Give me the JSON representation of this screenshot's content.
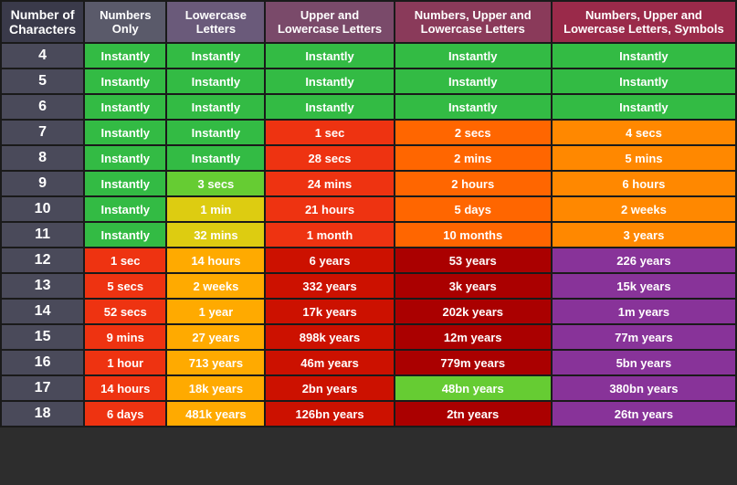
{
  "headers": {
    "col0": "Number of Characters",
    "col1": "Numbers Only",
    "col2": "Lowercase Letters",
    "col3": "Upper and Lowercase Letters",
    "col4": "Numbers, Upper and Lowercase Letters",
    "col5": "Numbers, Upper and Lowercase Letters, Symbols"
  },
  "rows": [
    {
      "num": "4",
      "c1": "Instantly",
      "c1_class": "instantly",
      "c2": "Instantly",
      "c2_class": "instantly",
      "c3": "Instantly",
      "c3_class": "instantly",
      "c4": "Instantly",
      "c4_class": "instantly",
      "c5": "Instantly",
      "c5_class": "instantly"
    },
    {
      "num": "5",
      "c1": "Instantly",
      "c1_class": "instantly",
      "c2": "Instantly",
      "c2_class": "instantly",
      "c3": "Instantly",
      "c3_class": "instantly",
      "c4": "Instantly",
      "c4_class": "instantly",
      "c5": "Instantly",
      "c5_class": "instantly"
    },
    {
      "num": "6",
      "c1": "Instantly",
      "c1_class": "instantly",
      "c2": "Instantly",
      "c2_class": "instantly",
      "c3": "Instantly",
      "c3_class": "instantly",
      "c4": "Instantly",
      "c4_class": "instantly",
      "c5": "Instantly",
      "c5_class": "instantly"
    },
    {
      "num": "7",
      "c1": "Instantly",
      "c1_class": "instantly",
      "c2": "Instantly",
      "c2_class": "instantly",
      "c3": "1 sec",
      "c3_class": "red1",
      "c4": "2 secs",
      "c4_class": "orange3",
      "c5": "4 secs",
      "c5_class": "orange2"
    },
    {
      "num": "8",
      "c1": "Instantly",
      "c1_class": "instantly",
      "c2": "Instantly",
      "c2_class": "instantly",
      "c3": "28 secs",
      "c3_class": "red1",
      "c4": "2 mins",
      "c4_class": "orange3",
      "c5": "5 mins",
      "c5_class": "orange2"
    },
    {
      "num": "9",
      "c1": "Instantly",
      "c1_class": "instantly",
      "c2": "3 secs",
      "c2_class": "green1",
      "c3": "24 mins",
      "c3_class": "red1",
      "c4": "2 hours",
      "c4_class": "orange3",
      "c5": "6 hours",
      "c5_class": "orange2"
    },
    {
      "num": "10",
      "c1": "Instantly",
      "c1_class": "instantly",
      "c2": "1 min",
      "c2_class": "yellow1",
      "c3": "21 hours",
      "c3_class": "red1",
      "c4": "5 days",
      "c4_class": "orange3",
      "c5": "2 weeks",
      "c5_class": "orange2"
    },
    {
      "num": "11",
      "c1": "Instantly",
      "c1_class": "instantly",
      "c2": "32 mins",
      "c2_class": "yellow1",
      "c3": "1 month",
      "c3_class": "red1",
      "c4": "10 months",
      "c4_class": "orange3",
      "c5": "3 years",
      "c5_class": "orange2"
    },
    {
      "num": "12",
      "c1": "1 sec",
      "c1_class": "red1",
      "c2": "14 hours",
      "c2_class": "orange1",
      "c3": "6 years",
      "c3_class": "red2",
      "c4": "53 years",
      "c4_class": "red3",
      "c5": "226 years",
      "c5_class": "purple1"
    },
    {
      "num": "13",
      "c1": "5 secs",
      "c1_class": "red1",
      "c2": "2 weeks",
      "c2_class": "orange1",
      "c3": "332 years",
      "c3_class": "red2",
      "c4": "3k years",
      "c4_class": "red3",
      "c5": "15k years",
      "c5_class": "purple1"
    },
    {
      "num": "14",
      "c1": "52 secs",
      "c1_class": "red1",
      "c2": "1 year",
      "c2_class": "orange1",
      "c3": "17k years",
      "c3_class": "red2",
      "c4": "202k years",
      "c4_class": "red3",
      "c5": "1m years",
      "c5_class": "purple1"
    },
    {
      "num": "15",
      "c1": "9 mins",
      "c1_class": "red1",
      "c2": "27 years",
      "c2_class": "orange1",
      "c3": "898k years",
      "c3_class": "red2",
      "c4": "12m years",
      "c4_class": "red3",
      "c5": "77m years",
      "c5_class": "purple1"
    },
    {
      "num": "16",
      "c1": "1 hour",
      "c1_class": "red1",
      "c2": "713 years",
      "c2_class": "orange1",
      "c3": "46m years",
      "c3_class": "red2",
      "c4": "779m years",
      "c4_class": "red3",
      "c5": "5bn years",
      "c5_class": "purple1"
    },
    {
      "num": "17",
      "c1": "14 hours",
      "c1_class": "red1",
      "c2": "18k years",
      "c2_class": "orange1",
      "c3": "2bn years",
      "c3_class": "red2",
      "c4": "48bn years",
      "c4_class": "green1",
      "c5": "380bn years",
      "c5_class": "purple1"
    },
    {
      "num": "18",
      "c1": "6 days",
      "c1_class": "red1",
      "c2": "481k years",
      "c2_class": "orange1",
      "c3": "126bn years",
      "c3_class": "red2",
      "c4": "2tn years",
      "c4_class": "red3",
      "c5": "26tn years",
      "c5_class": "purple1"
    }
  ]
}
